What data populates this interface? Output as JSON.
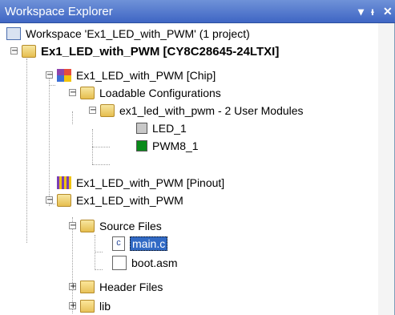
{
  "window": {
    "title": "Workspace Explorer",
    "dropdown_glyph": "▾",
    "pin_glyph": "ᵻ",
    "close_glyph": "✕"
  },
  "tree": {
    "workspace": "Workspace 'Ex1_LED_with_PWM' (1 project)",
    "project": "Ex1_LED_with_PWM [CY8C28645-24LTXI]",
    "chip": "Ex1_LED_with_PWM [Chip]",
    "loadable": "Loadable Configurations",
    "config": "ex1_led_with_pwm - 2 User Modules",
    "modules": [
      {
        "label": "LED_1",
        "color": "#c8c8c8"
      },
      {
        "label": "PWM8_1",
        "color": "#0a8a1a"
      }
    ],
    "pinout": "Ex1_LED_with_PWM [Pinout]",
    "project_folder": "Ex1_LED_with_PWM",
    "source_files": "Source Files",
    "files": [
      "main.c",
      "boot.asm"
    ],
    "header_files": "Header Files",
    "lib": "lib",
    "expander_glyphs": {
      "open": "−",
      "closed": "+"
    },
    "file_c_glyph": "c"
  },
  "colors": {
    "titlebar": "#4a6fc9",
    "selection": "#316ac5"
  }
}
